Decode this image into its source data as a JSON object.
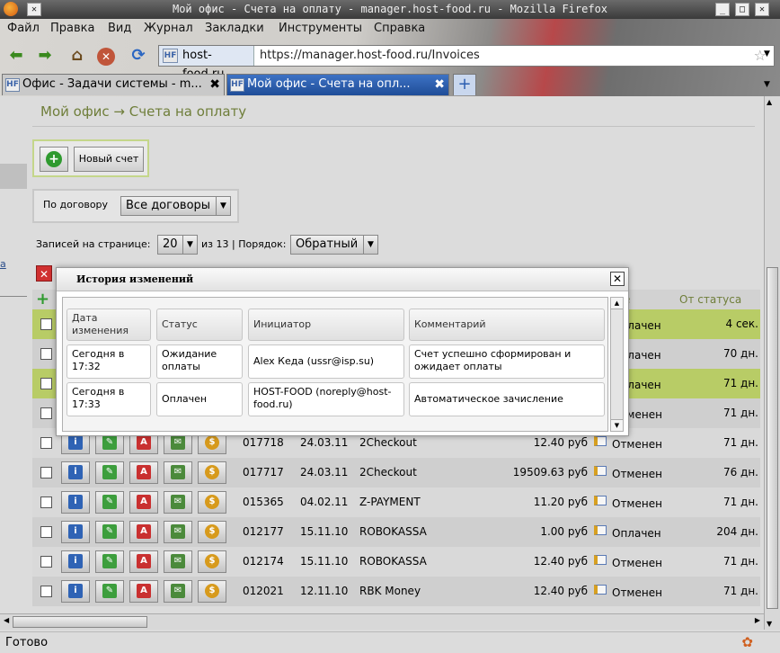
{
  "window": {
    "title": "Мой офис - Счета на оплату - manager.host-food.ru - Mozilla Firefox"
  },
  "menu": [
    "Файл",
    "Правка",
    "Вид",
    "Журнал",
    "Закладки",
    "Инструменты",
    "Справка"
  ],
  "urlbar": {
    "site": "host-food.ru",
    "url": "https://manager.host-food.ru/Invoices",
    "favicon": "HF"
  },
  "tabs": [
    {
      "label": "Офис - Задачи системы - m...",
      "close": "✖"
    },
    {
      "label": "Мой офис - Счета на опл...",
      "close": "✖"
    }
  ],
  "page": {
    "breadcrumb": "Мой офис → Счета на оплату",
    "new_invoice": "Новый счет",
    "filter_label": "По договору",
    "filter_value": "Все договоры",
    "per_page_label": "Записей на странице:",
    "per_page_value": "20",
    "of_total": "из 13 | Порядок:",
    "order_value": "Обратный",
    "col_from_status": "От статуса",
    "col_status_partial": "е"
  },
  "rows": [
    {
      "id": "",
      "date": "",
      "system": "",
      "sum": "",
      "status": "Оплачен",
      "age": "4 сек.",
      "highlight": true
    },
    {
      "id": "",
      "date": "",
      "system": "",
      "sum": "",
      "status": "Оплачен",
      "age": "70 дн.",
      "highlight": false
    },
    {
      "id": "",
      "date": "",
      "system": "",
      "sum": "",
      "status": "Оплачен",
      "age": "71 дн.",
      "highlight": true
    },
    {
      "id": "",
      "date": "",
      "system": "",
      "sum": "",
      "status": "Отменен",
      "age": "71 дн.",
      "highlight": false
    },
    {
      "id": "017718",
      "date": "24.03.11",
      "system": "2Checkout",
      "sum": "12.40 руб",
      "status": "Отменен",
      "age": "71 дн.",
      "highlight": false
    },
    {
      "id": "017717",
      "date": "24.03.11",
      "system": "2Checkout",
      "sum": "19509.63 руб",
      "status": "Отменен",
      "age": "76 дн.",
      "highlight": false
    },
    {
      "id": "015365",
      "date": "04.02.11",
      "system": "Z-PAYMENT",
      "sum": "11.20 руб",
      "status": "Отменен",
      "age": "71 дн.",
      "highlight": false
    },
    {
      "id": "012177",
      "date": "15.11.10",
      "system": "ROBOKASSA",
      "sum": "1.00 руб",
      "status": "Оплачен",
      "age": "204 дн.",
      "highlight": false
    },
    {
      "id": "012174",
      "date": "15.11.10",
      "system": "ROBOKASSA",
      "sum": "12.40 руб",
      "status": "Отменен",
      "age": "71 дн.",
      "highlight": false
    },
    {
      "id": "012021",
      "date": "12.11.10",
      "system": "RBK Money",
      "sum": "12.40 руб",
      "status": "Отменен",
      "age": "71 дн.",
      "highlight": false
    }
  ],
  "modal": {
    "title": "История изменений",
    "close": "✕",
    "headers": [
      "Дата изменения",
      "Статус",
      "Инициатор",
      "Комментарий"
    ],
    "entries": [
      {
        "date": "Сегодня в 17:32",
        "status": "Ожидание оплаты",
        "initiator": "Alex Кеда (ussr@isp.su)",
        "comment": "Счет успешно сформирован и ожидает оплаты"
      },
      {
        "date": "Сегодня в 17:33",
        "status": "Оплачен",
        "initiator": "HOST-FOOD (noreply@host-food.ru)",
        "comment": "Автоматическое зачисление"
      }
    ]
  },
  "status": {
    "text": "Готово"
  },
  "colors": {
    "accent": "#b8cc66",
    "breadcrumb": "#6f7e3a"
  }
}
